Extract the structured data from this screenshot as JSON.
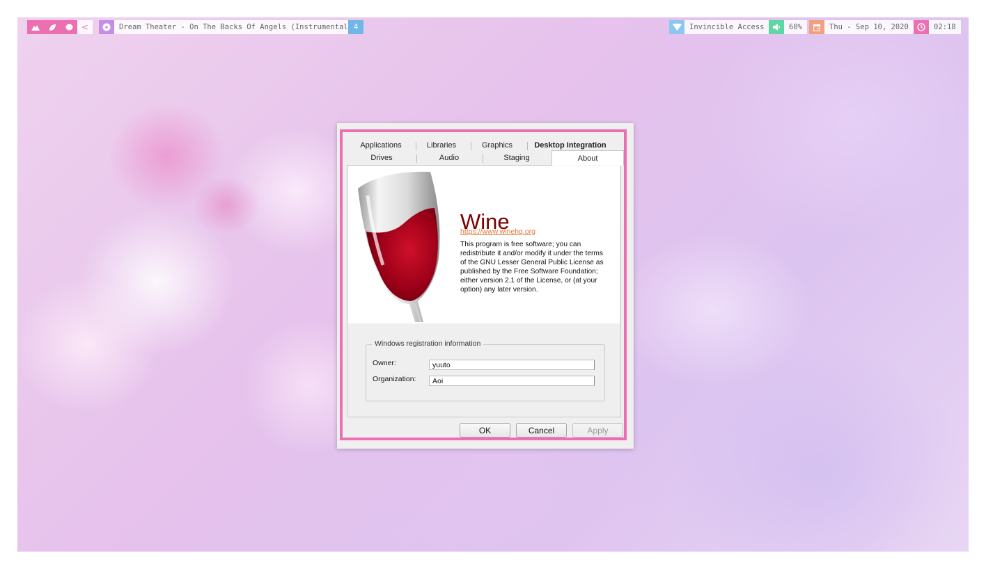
{
  "topbar": {
    "workspace_icons": [
      "mountain-icon",
      "leaf-icon",
      "pebble-icon"
    ],
    "nav_prev": "<",
    "media": {
      "icon": "disc-icon",
      "title": "Dream Theater - On The Backs Of Angels (Instrumental)"
    },
    "counter": "4",
    "network": {
      "icon": "wifi-icon",
      "ssid": "Invincible Access"
    },
    "volume": {
      "icon": "speaker-icon",
      "level": "60%"
    },
    "date": {
      "icon": "calendar-icon",
      "text": "Thu - Sep 10, 2020"
    },
    "clock": {
      "icon": "clock-icon",
      "time": "02:18"
    },
    "colors": {
      "pink": "#ec6fb2",
      "purple": "#c48de8",
      "blue": "#6fb7e6",
      "light_blue": "#8cc8ee",
      "green": "#5fd6a6",
      "orange": "#f0a080"
    }
  },
  "dialog": {
    "tabs_row1": [
      "Applications",
      "Libraries",
      "Graphics",
      "Desktop Integration"
    ],
    "tabs_row2": [
      "Drives",
      "Audio",
      "Staging",
      "About"
    ],
    "active_tab": "About",
    "about": {
      "title": "Wine",
      "url": "https://www.winehq.org",
      "license": "This program is free software; you can redistribute it and/or modify it under the terms of the GNU Lesser General Public License as published by the Free Software Foundation; either version 2.1 of the License, or (at your option) any later version."
    },
    "registration": {
      "group_title": "Windows registration information",
      "owner_label": "Owner:",
      "owner_value": "yuuto",
      "org_label": "Organization:",
      "org_value": "Aoi"
    },
    "buttons": {
      "ok": "OK",
      "cancel": "Cancel",
      "apply": "Apply"
    },
    "border_color": "#ec6fb2",
    "wine_color": "#7a0000"
  }
}
